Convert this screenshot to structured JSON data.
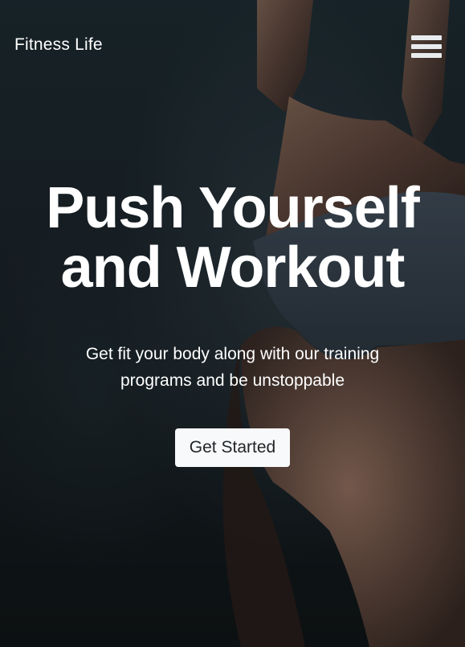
{
  "navbar": {
    "brand": "Fitness Life",
    "menu_icon": "hamburger-menu-icon"
  },
  "hero": {
    "headline_line1": "Push Yourself",
    "headline_line2": "and Workout",
    "subtext_line1": "Get fit your body along with our training",
    "subtext_line2": "programs and be unstoppable",
    "cta_label": "Get Started",
    "background_image": "woman-in-athletic-shorts-photo"
  },
  "colors": {
    "text": "#ffffff",
    "button_bg": "#f8f9fa",
    "button_text": "#212529",
    "background_dark": "#141b1f"
  }
}
